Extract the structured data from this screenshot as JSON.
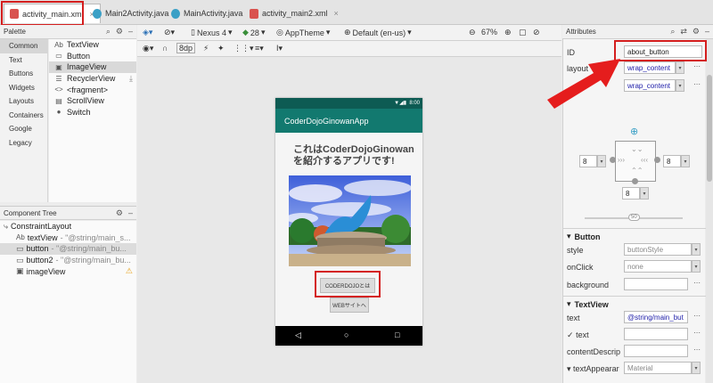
{
  "tabs": [
    {
      "label": "activity_main.xml",
      "icon": "xml-file-icon",
      "color": "#d9534f",
      "active": true
    },
    {
      "label": "Main2Activity.java",
      "icon": "java-class-icon",
      "color": "#3aa0c6"
    },
    {
      "label": "MainActivity.java",
      "icon": "java-class-icon",
      "color": "#3aa0c6"
    },
    {
      "label": "activity_main2.xml",
      "icon": "xml-file-icon",
      "color": "#d9534f"
    }
  ],
  "palette": {
    "title": "Palette",
    "categories": [
      "Common",
      "Text",
      "Buttons",
      "Widgets",
      "Layouts",
      "Containers",
      "Google",
      "Legacy"
    ],
    "items": [
      {
        "icon": "Ab",
        "label": "TextView"
      },
      {
        "icon": "▭",
        "label": "Button"
      },
      {
        "icon": "▣",
        "label": "ImageView"
      },
      {
        "icon": "☰",
        "label": "RecyclerView"
      },
      {
        "icon": "<>",
        "label": "<fragment>"
      },
      {
        "icon": "▤",
        "label": "ScrollView"
      },
      {
        "icon": "●",
        "label": "Switch"
      }
    ]
  },
  "tree": {
    "title": "Component Tree",
    "nodes": [
      {
        "label": "ConstraintLayout",
        "detail": ""
      },
      {
        "label": "textView",
        "detail": "- \"@string/main_s..."
      },
      {
        "label": "button",
        "detail": "- \"@string/main_bu..."
      },
      {
        "label": "button2",
        "detail": "- \"@string/main_bu..."
      },
      {
        "label": "imageView",
        "detail": ""
      }
    ]
  },
  "toolbar": {
    "device": "Nexus 4",
    "api": "28",
    "theme": "AppTheme",
    "locale": "Default (en-us)",
    "zoom": "67%",
    "margin": "8dp"
  },
  "phone": {
    "time": "8:00",
    "app_title": "CoderDojoGinowanApp",
    "headline_1": "これはCoderDojoGinowan",
    "headline_2": "を紹介するアプリです!",
    "button1": "CODERDOJOとは",
    "button2": "WEBサイトへ"
  },
  "attributes": {
    "title": "Attributes",
    "id_label": "ID",
    "id_value": "about_button",
    "layout_width_label": "layout",
    "layout_width_value": "wrap_content",
    "layout_height_value": "wrap_content",
    "margin_left": "8",
    "margin_right": "8",
    "margin_bottom": "8",
    "bias": "50",
    "button_section": "Button",
    "style_label": "style",
    "style_value": "buttonStyle",
    "onclick_label": "onClick",
    "onclick_value": "none",
    "background_label": "background",
    "textview_section": "TextView",
    "text_label": "text",
    "text_value": "@string/main_but",
    "text2_label": "text",
    "content_label": "contentDescrip",
    "appearance_label": "textAppearar",
    "appearance_value": "Material"
  }
}
